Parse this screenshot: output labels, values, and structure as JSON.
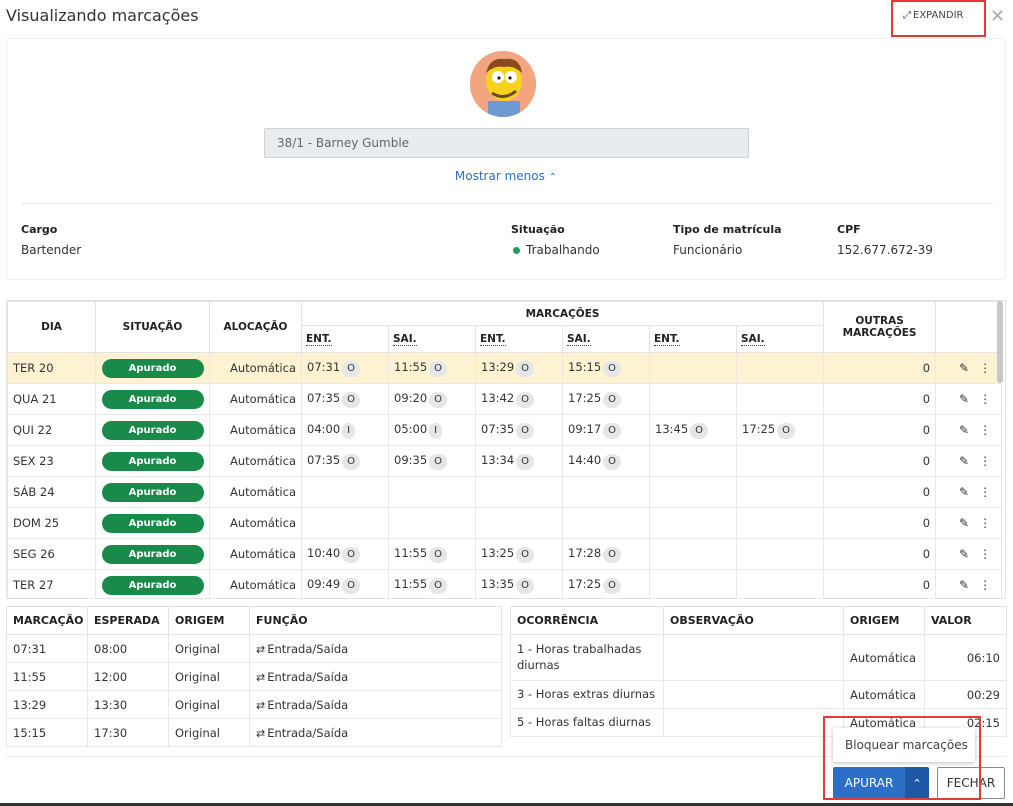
{
  "header": {
    "title": "Visualizando marcações",
    "expand_label": "EXPANDIR",
    "close_icon": "close-icon"
  },
  "employee": {
    "name": "38/1 - Barney Gumble",
    "show_less": "Mostrar menos",
    "cargo_label": "Cargo",
    "cargo": "Bartender",
    "situacao_label": "Situação",
    "situacao": "Trabalhando",
    "tipo_label": "Tipo de matrícula",
    "tipo": "Funcionário",
    "cpf_label": "CPF",
    "cpf": "152.677.672-39",
    "status_color": "#1e9e58"
  },
  "main_table": {
    "headers": {
      "dia": "DIA",
      "situacao": "SITUAÇÃO",
      "alocacao": "ALOCAÇÃO",
      "marcacoes": "MARCAÇÕES",
      "outras": "OUTRAS MARCAÇÕES"
    },
    "sub": [
      "ENT.",
      "SAI.",
      "ENT.",
      "SAI.",
      "ENT.",
      "SAI."
    ],
    "rows": [
      {
        "dia": "TER 20",
        "situacao": "Apurado",
        "alocacao": "Automática",
        "m": [
          [
            "07:31",
            "O"
          ],
          [
            "11:55",
            "O"
          ],
          [
            "13:29",
            "O"
          ],
          [
            "15:15",
            "O"
          ],
          [
            "",
            ""
          ],
          [
            "",
            ""
          ]
        ],
        "outras": "0",
        "selected": true
      },
      {
        "dia": "QUA 21",
        "situacao": "Apurado",
        "alocacao": "Automática",
        "m": [
          [
            "07:35",
            "O"
          ],
          [
            "09:20",
            "O"
          ],
          [
            "13:42",
            "O"
          ],
          [
            "17:25",
            "O"
          ],
          [
            "",
            ""
          ],
          [
            "",
            ""
          ]
        ],
        "outras": "0"
      },
      {
        "dia": "QUI 22",
        "situacao": "Apurado",
        "alocacao": "Automática",
        "m": [
          [
            "04:00",
            "I"
          ],
          [
            "05:00",
            "I"
          ],
          [
            "07:35",
            "O"
          ],
          [
            "09:17",
            "O"
          ],
          [
            "13:45",
            "O"
          ],
          [
            "17:25",
            "O"
          ]
        ],
        "outras": "0"
      },
      {
        "dia": "SEX 23",
        "situacao": "Apurado",
        "alocacao": "Automática",
        "m": [
          [
            "07:35",
            "O"
          ],
          [
            "09:35",
            "O"
          ],
          [
            "13:34",
            "O"
          ],
          [
            "14:40",
            "O"
          ],
          [
            "",
            ""
          ],
          [
            "",
            ""
          ]
        ],
        "outras": "0"
      },
      {
        "dia": "SÁB 24",
        "situacao": "Apurado",
        "alocacao": "Automática",
        "m": [
          [
            "",
            ""
          ],
          [
            "",
            ""
          ],
          [
            "",
            ""
          ],
          [
            "",
            ""
          ],
          [
            "",
            ""
          ],
          [
            "",
            ""
          ]
        ],
        "outras": "0"
      },
      {
        "dia": "DOM 25",
        "situacao": "Apurado",
        "alocacao": "Automática",
        "m": [
          [
            "",
            ""
          ],
          [
            "",
            ""
          ],
          [
            "",
            ""
          ],
          [
            "",
            ""
          ],
          [
            "",
            ""
          ],
          [
            "",
            ""
          ]
        ],
        "outras": "0"
      },
      {
        "dia": "SEG 26",
        "situacao": "Apurado",
        "alocacao": "Automática",
        "m": [
          [
            "10:40",
            "O"
          ],
          [
            "11:55",
            "O"
          ],
          [
            "13:25",
            "O"
          ],
          [
            "17:28",
            "O"
          ],
          [
            "",
            ""
          ],
          [
            "",
            ""
          ]
        ],
        "outras": "0"
      },
      {
        "dia": "TER 27",
        "situacao": "Apurado",
        "alocacao": "Automática",
        "m": [
          [
            "09:49",
            "O"
          ],
          [
            "11:55",
            "O"
          ],
          [
            "13:35",
            "O"
          ],
          [
            "17:25",
            "O"
          ],
          [
            "",
            ""
          ],
          [
            "",
            ""
          ]
        ],
        "outras": "0"
      }
    ],
    "badge_color": "#1a8a4a",
    "selected_color": "#fdf3d2"
  },
  "marcacoes_table": {
    "headers": [
      "MARCAÇÃO",
      "ESPERADA",
      "ORIGEM",
      "FUNÇÃO"
    ],
    "rows": [
      [
        "07:31",
        "08:00",
        "Original",
        "Entrada/Saída"
      ],
      [
        "11:55",
        "12:00",
        "Original",
        "Entrada/Saída"
      ],
      [
        "13:29",
        "13:30",
        "Original",
        "Entrada/Saída"
      ],
      [
        "15:15",
        "17:30",
        "Original",
        "Entrada/Saída"
      ]
    ]
  },
  "ocorrencias_table": {
    "headers": [
      "OCORRÊNCIA",
      "OBSERVAÇÃO",
      "ORIGEM",
      "VALOR"
    ],
    "rows": [
      [
        "1 - Horas trabalhadas diurnas",
        "",
        "Automática",
        "06:10"
      ],
      [
        "3 - Horas extras diurnas",
        "",
        "Automática",
        "00:29"
      ],
      [
        "5 - Horas faltas diurnas",
        "",
        "Automática",
        "02:15"
      ]
    ]
  },
  "footer": {
    "menu_item": "Bloquear marcações",
    "apurar": "APURAR",
    "fechar": "FECHAR",
    "primary_color": "#2d6fc7"
  }
}
